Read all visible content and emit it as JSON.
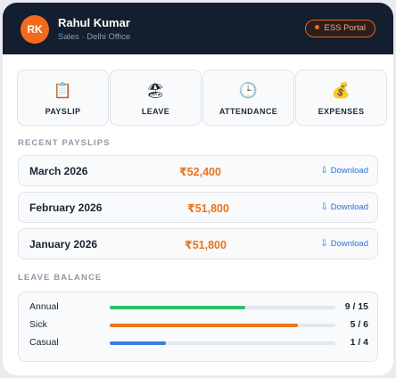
{
  "header": {
    "avatar_initials": "RK",
    "user_name": "Rahul Kumar",
    "user_subtitle": "Sales · Delhi Office",
    "portal_badge": "ESS Portal",
    "accent_color": "#f26b1d"
  },
  "quick_actions": [
    {
      "label": "PAYSLIP",
      "icon": "clipboard-icon",
      "glyph": "📋"
    },
    {
      "label": "LEAVE",
      "icon": "calendar-icon",
      "glyph": "🏖"
    },
    {
      "label": "ATTENDANCE",
      "icon": "clock-icon",
      "glyph": "🕒"
    },
    {
      "label": "EXPENSES",
      "icon": "money-bag-icon",
      "glyph": "💰"
    }
  ],
  "payslips": {
    "title": "RECENT PAYSLIPS",
    "download_label": "Download",
    "download_icon": "download-icon",
    "rows": [
      {
        "month": "March 2026",
        "amount": "₹52,400"
      },
      {
        "month": "February 2026",
        "amount": "₹51,800"
      },
      {
        "month": "January 2026",
        "amount": "₹51,800"
      }
    ]
  },
  "leave_balance": {
    "title": "LEAVE BALANCE",
    "rows": [
      {
        "label": "Annual",
        "count": "9 / 15",
        "fraction": 0.6,
        "color": "#2fbe6a"
      },
      {
        "label": "Sick",
        "count": "5 / 6",
        "fraction": 0.833,
        "color": "#ee7420"
      },
      {
        "label": "Casual",
        "count": "1 / 4",
        "fraction": 0.25,
        "color": "#3c7fe0"
      }
    ]
  }
}
